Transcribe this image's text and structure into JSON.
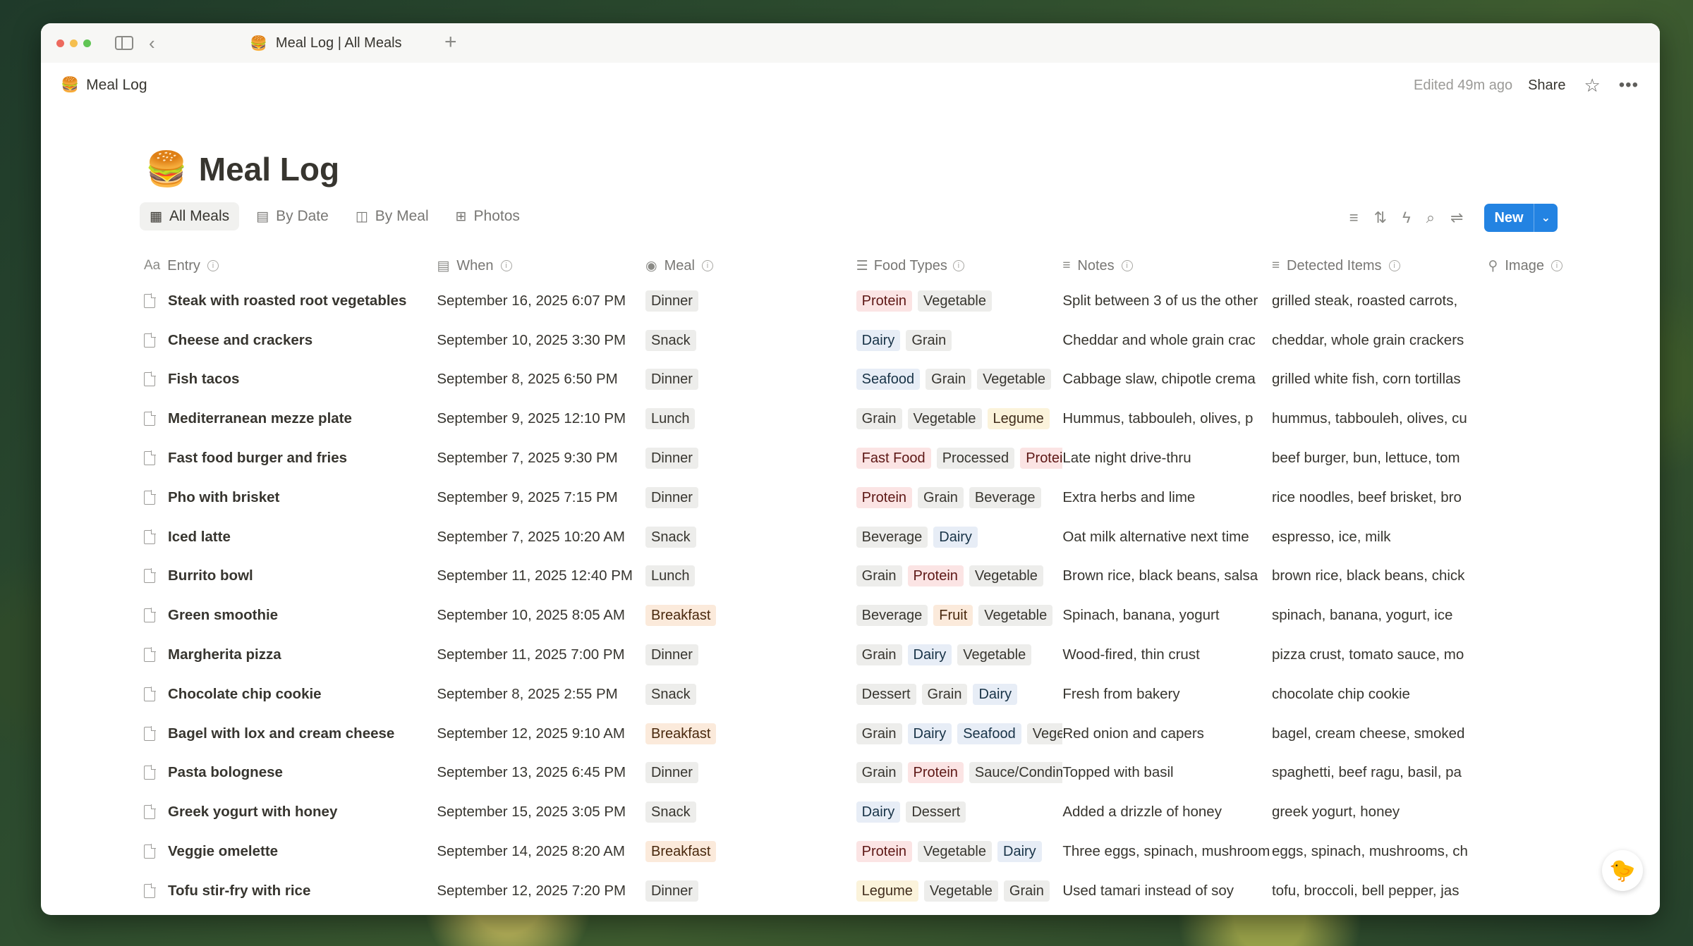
{
  "window": {
    "tab_title": "Meal Log | All Meals",
    "tab_icon": "🍔",
    "new_tab_glyph": "+"
  },
  "topbar": {
    "breadcrumb": "Meal Log",
    "edited": "Edited 49m ago",
    "share": "Share"
  },
  "page": {
    "title": "Meal Log",
    "icon": "🍔"
  },
  "views": [
    {
      "label": "All Meals",
      "icon": "table-icon",
      "active": true
    },
    {
      "label": "By Date",
      "icon": "calendar-icon",
      "active": false
    },
    {
      "label": "By Meal",
      "icon": "board-icon",
      "active": false
    },
    {
      "label": "Photos",
      "icon": "gallery-icon",
      "active": false
    }
  ],
  "toolbar": {
    "new_label": "New"
  },
  "columns": {
    "entry": "Entry",
    "when": "When",
    "meal": "Meal",
    "types": "Food Types",
    "notes": "Notes",
    "detected": "Detected Items",
    "image": "Image"
  },
  "meal_colors": {
    "Dinner": {
      "bg": "#ededeb",
      "fg": "#37352f"
    },
    "Snack": {
      "bg": "#ededeb",
      "fg": "#37352f"
    },
    "Lunch": {
      "bg": "#ededeb",
      "fg": "#37352f"
    },
    "Breakfast": {
      "bg": "#fbeadb",
      "fg": "#49290e"
    }
  },
  "tag_colors": {
    "Protein": {
      "bg": "#fbe4e4",
      "fg": "#5d1715"
    },
    "Vegetable": {
      "bg": "#ededeb",
      "fg": "#37352f"
    },
    "Dairy": {
      "bg": "#e7edf6",
      "fg": "#183347"
    },
    "Grain": {
      "bg": "#ededeb",
      "fg": "#37352f"
    },
    "Seafood": {
      "bg": "#e7edf6",
      "fg": "#183347"
    },
    "Legume": {
      "bg": "#fbf3db",
      "fg": "#402c1b"
    },
    "Fast Food": {
      "bg": "#fbe4e4",
      "fg": "#5d1715"
    },
    "Processed": {
      "bg": "#ededeb",
      "fg": "#37352f"
    },
    "Beverage": {
      "bg": "#ededeb",
      "fg": "#37352f"
    },
    "Fruit": {
      "bg": "#fbeadb",
      "fg": "#49290e"
    },
    "Dessert": {
      "bg": "#ededeb",
      "fg": "#37352f"
    },
    "Sauce/Condiment": {
      "bg": "#ededeb",
      "fg": "#37352f"
    }
  },
  "rows": [
    {
      "entry": "Steak with roasted root vegetables",
      "when": "September 16, 2025 6:07 PM",
      "meal": "Dinner",
      "types": [
        "Protein",
        "Vegetable"
      ],
      "notes": "Split between 3 of us the other",
      "detected": "grilled steak, roasted carrots,"
    },
    {
      "entry": "Cheese and crackers",
      "when": "September 10, 2025 3:30 PM",
      "meal": "Snack",
      "types": [
        "Dairy",
        "Grain"
      ],
      "notes": "Cheddar and whole grain crac",
      "detected": "cheddar, whole grain crackers"
    },
    {
      "entry": "Fish tacos",
      "when": "September 8, 2025 6:50 PM",
      "meal": "Dinner",
      "types": [
        "Seafood",
        "Grain",
        "Vegetable"
      ],
      "notes": "Cabbage slaw, chipotle crema",
      "detected": "grilled white fish, corn tortillas"
    },
    {
      "entry": "Mediterranean mezze plate",
      "when": "September 9, 2025 12:10 PM",
      "meal": "Lunch",
      "types": [
        "Grain",
        "Vegetable",
        "Legume"
      ],
      "notes": "Hummus, tabbouleh, olives, p",
      "detected": "hummus, tabbouleh, olives, cu"
    },
    {
      "entry": "Fast food burger and fries",
      "when": "September 7, 2025 9:30 PM",
      "meal": "Dinner",
      "types": [
        "Fast Food",
        "Processed",
        "Protein"
      ],
      "notes": "Late night drive-thru",
      "detected": "beef burger, bun, lettuce, tom"
    },
    {
      "entry": "Pho with brisket",
      "when": "September 9, 2025 7:15 PM",
      "meal": "Dinner",
      "types": [
        "Protein",
        "Grain",
        "Beverage"
      ],
      "notes": "Extra herbs and lime",
      "detected": "rice noodles, beef brisket, bro"
    },
    {
      "entry": "Iced latte",
      "when": "September 7, 2025 10:20 AM",
      "meal": "Snack",
      "types": [
        "Beverage",
        "Dairy"
      ],
      "notes": "Oat milk alternative next time",
      "detected": "espresso, ice, milk"
    },
    {
      "entry": "Burrito bowl",
      "when": "September 11, 2025 12:40 PM",
      "meal": "Lunch",
      "types": [
        "Grain",
        "Protein",
        "Vegetable"
      ],
      "notes": "Brown rice, black beans, salsa",
      "detected": "brown rice, black beans, chick"
    },
    {
      "entry": "Green smoothie",
      "when": "September 10, 2025 8:05 AM",
      "meal": "Breakfast",
      "types": [
        "Beverage",
        "Fruit",
        "Vegetable"
      ],
      "notes": "Spinach, banana, yogurt",
      "detected": "spinach, banana, yogurt, ice"
    },
    {
      "entry": "Margherita pizza",
      "when": "September 11, 2025 7:00 PM",
      "meal": "Dinner",
      "types": [
        "Grain",
        "Dairy",
        "Vegetable"
      ],
      "notes": "Wood-fired, thin crust",
      "detected": "pizza crust, tomato sauce, mo"
    },
    {
      "entry": "Chocolate chip cookie",
      "when": "September 8, 2025 2:55 PM",
      "meal": "Snack",
      "types": [
        "Dessert",
        "Grain",
        "Dairy"
      ],
      "notes": "Fresh from bakery",
      "detected": "chocolate chip cookie"
    },
    {
      "entry": "Bagel with lox and cream cheese",
      "when": "September 12, 2025 9:10 AM",
      "meal": "Breakfast",
      "types": [
        "Grain",
        "Dairy",
        "Seafood",
        "Vegetable"
      ],
      "notes": "Red onion and capers",
      "detected": "bagel, cream cheese, smoked"
    },
    {
      "entry": "Pasta bolognese",
      "when": "September 13, 2025 6:45 PM",
      "meal": "Dinner",
      "types": [
        "Grain",
        "Protein",
        "Sauce/Condiment"
      ],
      "notes": "Topped with basil",
      "detected": "spaghetti, beef ragu, basil, pa"
    },
    {
      "entry": "Greek yogurt with honey",
      "when": "September 15, 2025 3:05 PM",
      "meal": "Snack",
      "types": [
        "Dairy",
        "Dessert"
      ],
      "notes": "Added a drizzle of honey",
      "detected": "greek yogurt, honey"
    },
    {
      "entry": "Veggie omelette",
      "when": "September 14, 2025 8:20 AM",
      "meal": "Breakfast",
      "types": [
        "Protein",
        "Vegetable",
        "Dairy"
      ],
      "notes": "Three eggs, spinach, mushroom",
      "detected": "eggs, spinach, mushrooms, ch"
    },
    {
      "entry": "Tofu stir-fry with rice",
      "when": "September 12, 2025 7:20 PM",
      "meal": "Dinner",
      "types": [
        "Legume",
        "Vegetable",
        "Grain"
      ],
      "notes": "Used tamari instead of soy",
      "detected": "tofu, broccoli, bell pepper, jas"
    }
  ]
}
